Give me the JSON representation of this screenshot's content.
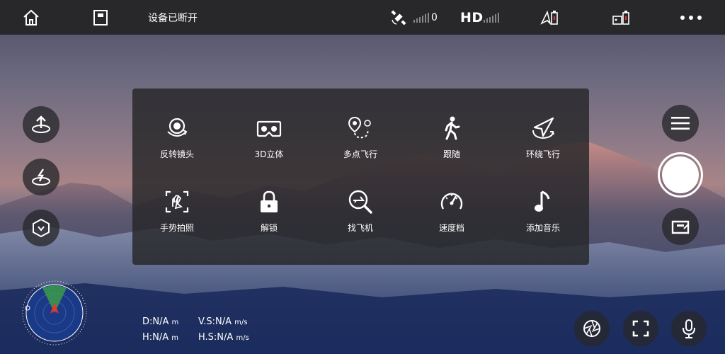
{
  "topbar": {
    "connection_status": "设备已断开",
    "satellite_count": "0",
    "video_quality": "HD",
    "icons": [
      "home-icon",
      "flight-log-icon",
      "satellite-icon",
      "signal-bars-icon",
      "drone-battery-icon",
      "remote-battery-icon",
      "more-icon"
    ]
  },
  "left_controls": [
    "takeoff-icon",
    "return-home-icon",
    "gimbal-mode-icon"
  ],
  "modes": [
    {
      "label": "反转镜头",
      "icon": "flip-camera-icon"
    },
    {
      "label": "3D立体",
      "icon": "vr-headset-icon"
    },
    {
      "label": "多点飞行",
      "icon": "waypoints-icon"
    },
    {
      "label": "跟随",
      "icon": "follow-walk-icon"
    },
    {
      "label": "环绕飞行",
      "icon": "orbit-icon"
    },
    {
      "label": "手势拍照",
      "icon": "gesture-photo-icon"
    },
    {
      "label": "解锁",
      "icon": "lock-icon"
    },
    {
      "label": "找飞机",
      "icon": "find-drone-icon"
    },
    {
      "label": "速度档",
      "icon": "speedometer-icon"
    },
    {
      "label": "添加音乐",
      "icon": "music-note-icon"
    }
  ],
  "telemetry": {
    "distance": "D:N/A",
    "height": "H:N/A",
    "vertical_speed": "V.S:N/A",
    "horizontal_speed": "H.S:N/A",
    "unit_m": "m",
    "unit_ms": "m/s"
  },
  "right_controls": [
    "menu-icon",
    "shutter-button",
    "media-gallery-icon"
  ],
  "bottom_controls": [
    "aperture-icon",
    "fullscreen-icon",
    "microphone-icon"
  ],
  "colors": {
    "accent_red": "#e8352e",
    "radar_green": "#3c9b4a",
    "panel_bg": "#262628"
  }
}
